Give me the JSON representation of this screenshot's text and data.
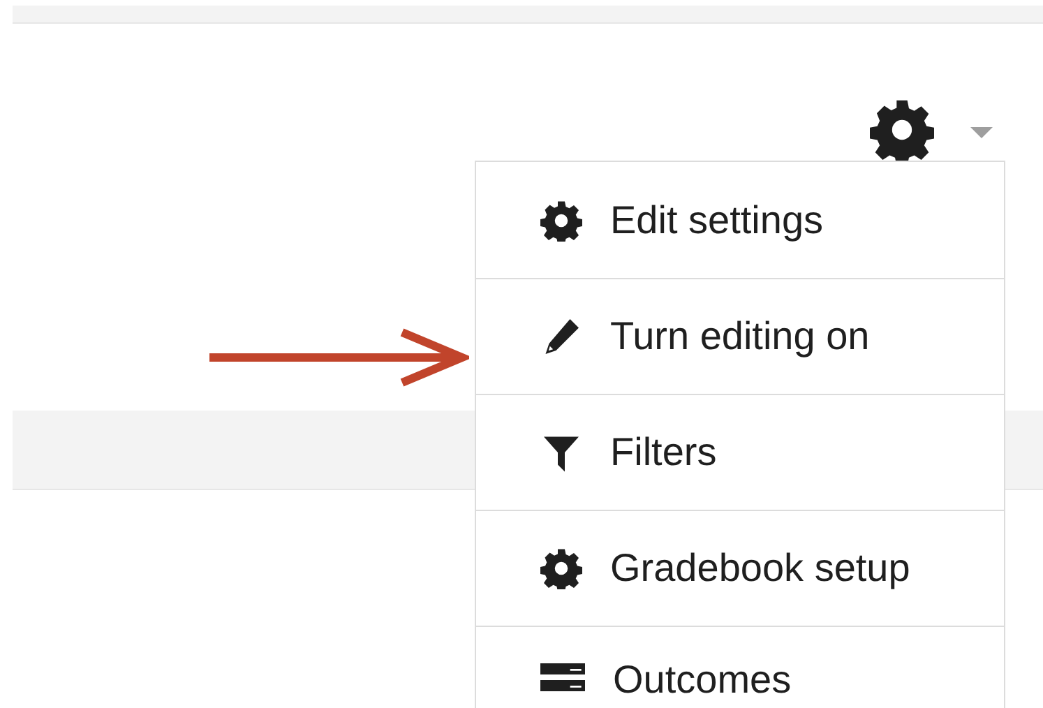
{
  "menu_items": [
    {
      "kind": "gear",
      "label": "Edit settings"
    },
    {
      "kind": "pencil",
      "label": "Turn editing on"
    },
    {
      "kind": "filter",
      "label": "Filters"
    },
    {
      "kind": "gear",
      "label": "Gradebook setup"
    },
    {
      "kind": "outcomes",
      "label": "Outcomes"
    }
  ]
}
